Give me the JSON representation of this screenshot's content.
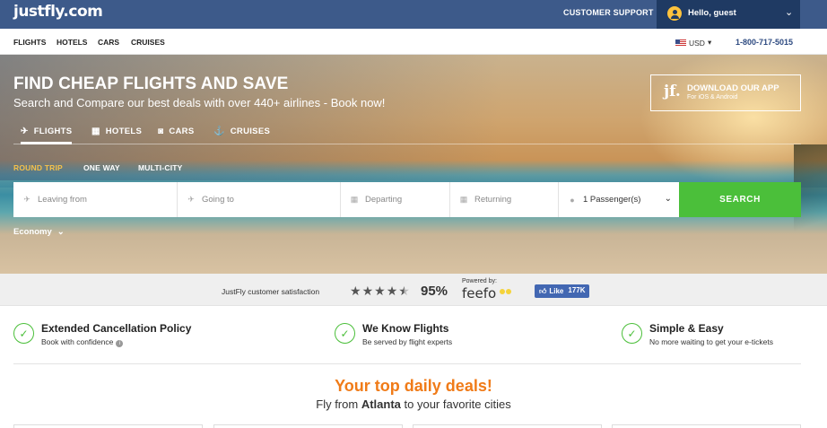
{
  "header": {
    "logo": "justfly.com",
    "customer_support": "CUSTOMER SUPPORT",
    "user_greeting": "Hello, guest",
    "user_chevron": "⌄"
  },
  "nav": {
    "items": [
      "FLIGHTS",
      "HOTELS",
      "CARS",
      "CRUISES"
    ],
    "currency": "USD",
    "currency_chevron": "▾",
    "phone": "1-800-717-5015"
  },
  "hero": {
    "title": "FIND CHEAP FLIGHTS AND SAVE",
    "subtitle": "Search and Compare our best deals with over 440+ airlines - Book now!",
    "app_logo": "jf.",
    "app_title": "DOWNLOAD OUR APP",
    "app_subtitle": "For iOS & Android"
  },
  "tabs": [
    {
      "label": "FLIGHTS",
      "icon": "✈"
    },
    {
      "label": "HOTELS",
      "icon": "▦"
    },
    {
      "label": "CARS",
      "icon": "◙"
    },
    {
      "label": "CRUISES",
      "icon": "⚓"
    }
  ],
  "trip_types": [
    "ROUND TRIP",
    "ONE WAY",
    "MULTI-CITY"
  ],
  "search_form": {
    "leaving_placeholder": "Leaving from",
    "going_placeholder": "Going to",
    "departing_placeholder": "Departing",
    "returning_placeholder": "Returning",
    "passengers": "1 Passenger(s)",
    "passengers_chevron": "⌄",
    "search_label": "SEARCH",
    "cabin_class": "Economy",
    "cabin_chevron": "⌄",
    "icons": {
      "leaving": "✈",
      "going": "✈",
      "departing": "▦",
      "returning": "▦",
      "passenger": "●"
    }
  },
  "satisfaction": {
    "label": "JustFly customer satisfaction",
    "rating_stars": 4.5,
    "percent": "95%",
    "powered_by": "Powered by:",
    "provider": "feefo",
    "fb_like": "Like",
    "fb_count": "177K"
  },
  "features": [
    {
      "title": "Extended Cancellation Policy",
      "subtitle": "Book with confidence"
    },
    {
      "title": "We Know Flights",
      "subtitle": "Be served by flight experts"
    },
    {
      "title": "Simple & Easy",
      "subtitle": "No more waiting to get your e-tickets"
    }
  ],
  "deals": {
    "title": "Your top daily deals!",
    "subtitle_prefix": "Fly from",
    "city": "Atlanta",
    "subtitle_suffix": "to your favorite cities"
  },
  "colors": {
    "topbar": "#3d5a8a",
    "user_box": "#1f3a63",
    "accent_orange": "#f07b18",
    "search_green": "#4bbf3a",
    "trip_active": "#f5c04a",
    "phone_blue": "#2d4a80"
  }
}
